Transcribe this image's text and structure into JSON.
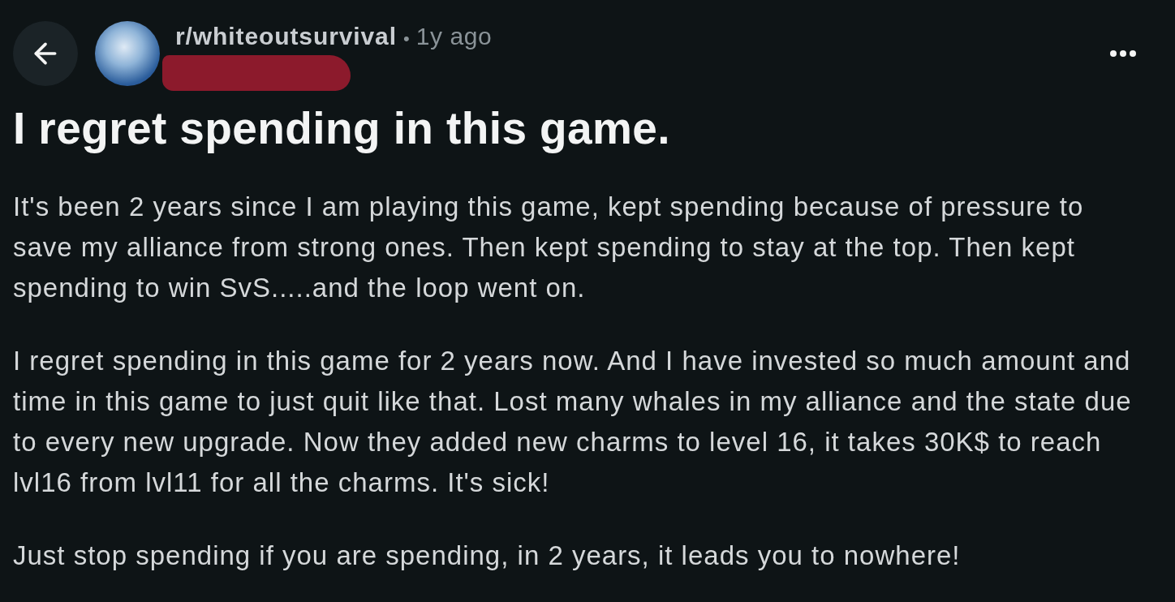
{
  "header": {
    "back_button": {
      "kind": "back"
    },
    "subreddit": "r/whiteoutsurvival",
    "separator": "•",
    "time": "1y ago",
    "author_redacted": true,
    "more_button": {
      "kind": "more"
    }
  },
  "post": {
    "title": "I regret spending in this game.",
    "paragraphs": [
      "It's been 2 years since I am playing this game, kept spending because of pressure to save my alliance from strong ones. Then kept spending to stay at the top. Then kept spending to win SvS.....and the loop went on.",
      "I regret spending in this game for 2 years now. And I have invested so much amount and time in this game to just quit like that. Lost many whales in my alliance and the state due to every new upgrade. Now they added new charms to level 16, it takes 30K$ to reach lvl16 from lvl11 for all the charms. It's sick!",
      "Just stop spending if you are spending, in 2 years, it leads you to nowhere!"
    ]
  }
}
